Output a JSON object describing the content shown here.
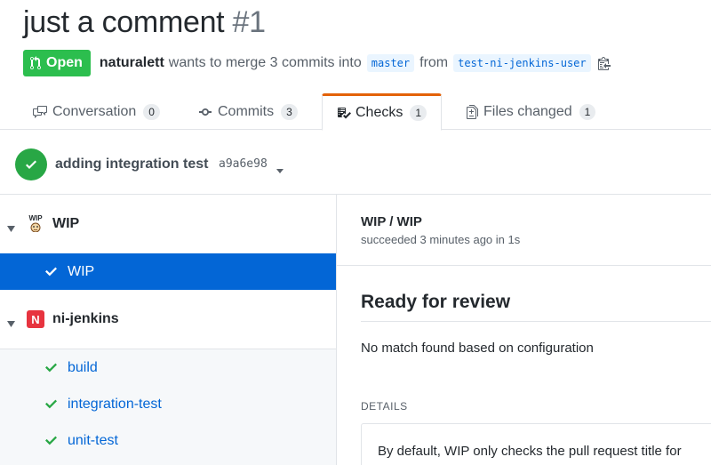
{
  "pr": {
    "title": "just a comment",
    "number": "#1",
    "state": "Open",
    "author": "naturalett",
    "merge_text": "wants to merge 3 commits into",
    "base_branch": "master",
    "from_text": "from",
    "head_branch": "test-ni-jenkins-user"
  },
  "tabs": [
    {
      "label": "Conversation",
      "count": "0"
    },
    {
      "label": "Commits",
      "count": "3"
    },
    {
      "label": "Checks",
      "count": "1"
    },
    {
      "label": "Files changed",
      "count": "1"
    }
  ],
  "commit": {
    "message": "adding integration test",
    "sha": "a9a6e98"
  },
  "sidebar": {
    "suites": [
      {
        "name": "WIP",
        "logo_text": "WIP",
        "runs": [
          {
            "name": "WIP"
          }
        ]
      },
      {
        "name": "ni-jenkins",
        "logo_text": "N",
        "runs": [
          {
            "name": "build"
          },
          {
            "name": "integration-test"
          },
          {
            "name": "unit-test"
          }
        ]
      }
    ]
  },
  "check": {
    "name": "WIP / WIP",
    "status": "succeeded 3 minutes ago in 1s",
    "result_title": "Ready for review",
    "summary": "No match found based on configuration",
    "details_label": "DETAILS",
    "details_text": "By default, WIP only checks the pull request title for"
  },
  "colors": {
    "success": "#28a745",
    "open_badge": "#2cbe4e",
    "link": "#0366d6",
    "tab_accent": "#e36209",
    "jenkins_logo": "#e7343f"
  }
}
